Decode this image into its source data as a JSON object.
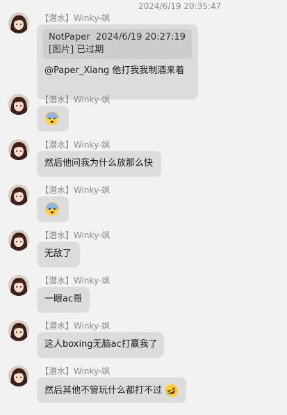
{
  "timestamp": "2024/6/19 20:35:47",
  "messages": [
    {
      "sender": "【潜水】Winky-飒",
      "quote": {
        "author": "NotPaper",
        "time": "2024/6/19 20:27:19",
        "text": "[图片] 已过期"
      },
      "text": "@Paper_Xiang 他打我我制酒来着"
    },
    {
      "sender": "【潜水】Winky-飒",
      "emoji": "fearful-face",
      "text": ""
    },
    {
      "sender": "【潜水】Winky-飒",
      "text": "然后他问我为什么放那么快"
    },
    {
      "sender": "【潜水】Winky-飒",
      "emoji": "fearful-face",
      "text": ""
    },
    {
      "sender": "【潜水】Winky-飒",
      "text": "无敌了"
    },
    {
      "sender": "【潜水】Winky-飒",
      "text": "一眼ac哥"
    },
    {
      "sender": "【潜水】Winky-飒",
      "text": "这人boxing无脑ac打赢我了"
    },
    {
      "sender": "【潜水】Winky-飒",
      "text": "然后其他不管玩什么都打不过",
      "trailing_emoji": "rolling-on-floor-laughing"
    }
  ]
}
